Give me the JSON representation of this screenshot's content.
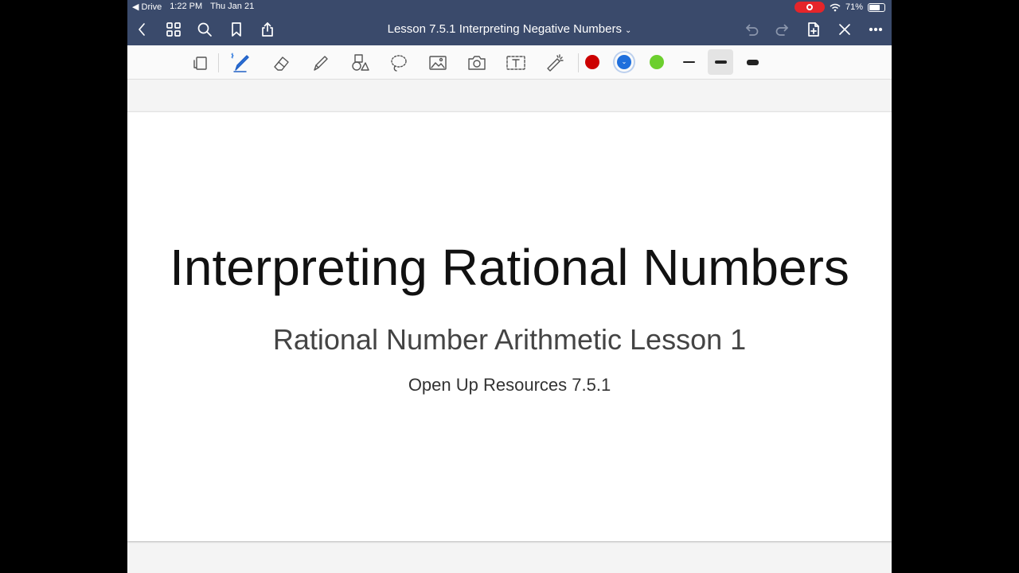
{
  "status_bar": {
    "back_app": "◀ Drive",
    "time": "1:22 PM",
    "date": "Thu Jan 21",
    "battery": "71%",
    "battery_level": 0.71
  },
  "nav": {
    "document_title": "Lesson 7.5.1 Interpreting Negative Numbers",
    "title_caret": "⌄"
  },
  "toolbar": {
    "tools": [
      "page-thumbnail",
      "pen",
      "eraser",
      "highlighter",
      "shapes",
      "lasso",
      "image",
      "camera",
      "text",
      "laser-pointer"
    ],
    "colors": [
      "#cc0000",
      "#1f6fdc",
      "#6ccf2e"
    ],
    "selected_color": "#1f6fdc",
    "stroke_widths": [
      "thin",
      "medium",
      "thick"
    ],
    "selected_stroke": "medium"
  },
  "page": {
    "title": "Interpreting Rational Numbers",
    "subtitle": "Rational Number Arithmetic Lesson 1",
    "source": "Open Up Resources 7.5.1"
  }
}
